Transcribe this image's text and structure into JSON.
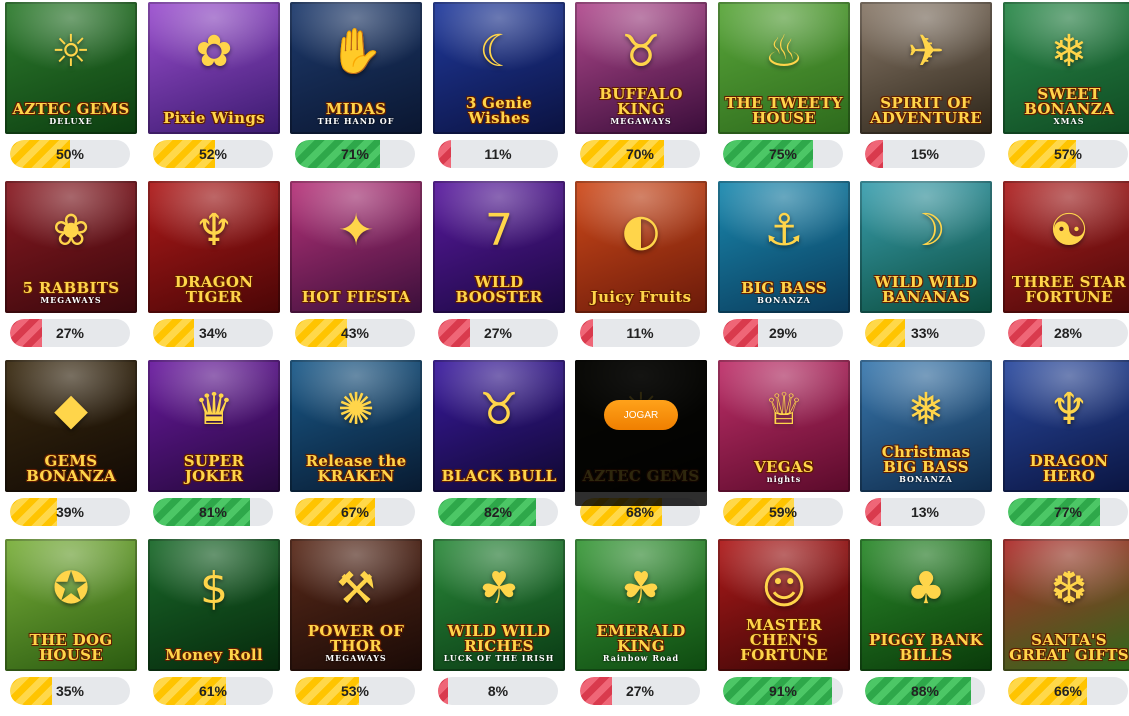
{
  "play_button_label": "JOGAR",
  "colors": {
    "high": "#2ea84a",
    "mid": "#ffc400",
    "low": "#d93a4d",
    "track": "#e6e8eb",
    "play_button": "#f7941d"
  },
  "games": [
    {
      "title": "AZTEC GEMS",
      "subtitle": "DELUXE",
      "percent": "50%",
      "value": 50,
      "level": "yellow",
      "icon": "aztec-mask-icon",
      "bg": [
        "#2e7d2e",
        "#0c3d10"
      ]
    },
    {
      "title": "Pixie Wings",
      "subtitle": "",
      "percent": "52%",
      "value": 52,
      "level": "yellow",
      "icon": "fairy-icon",
      "bg": [
        "#9c4fd0",
        "#3a1a6e"
      ]
    },
    {
      "title": "MIDAS",
      "subtitle": "THE HAND OF",
      "percent": "71%",
      "value": 71,
      "level": "green",
      "icon": "golden-hand-icon",
      "bg": [
        "#1e3b6e",
        "#0a1630"
      ]
    },
    {
      "title": "3 Genie Wishes",
      "subtitle": "",
      "percent": "11%",
      "value": 11,
      "level": "red",
      "icon": "genie-icon",
      "bg": [
        "#203a9e",
        "#0b1240"
      ]
    },
    {
      "title": "BUFFALO KING",
      "subtitle": "MEGAWAYS",
      "percent": "70%",
      "value": 70,
      "level": "yellow",
      "icon": "buffalo-icon",
      "bg": [
        "#b24a8e",
        "#3a0d3a"
      ]
    },
    {
      "title": "THE TWEETY HOUSE",
      "subtitle": "",
      "percent": "75%",
      "value": 75,
      "level": "green",
      "icon": "rooster-icon",
      "bg": [
        "#5aa73a",
        "#2d6a1c"
      ]
    },
    {
      "title": "SPIRIT OF ADVENTURE",
      "subtitle": "",
      "percent": "15%",
      "value": 15,
      "level": "red",
      "icon": "aviator-icon",
      "bg": [
        "#8a7a6a",
        "#2c2418"
      ]
    },
    {
      "title": "SWEET BONANZA",
      "subtitle": "XMAS",
      "percent": "57%",
      "value": 57,
      "level": "yellow",
      "icon": "candy-icon",
      "bg": [
        "#2a8a4a",
        "#0f4a22"
      ]
    },
    {
      "title": "5 RABBITS",
      "subtitle": "MEGAWAYS",
      "percent": "27%",
      "value": 27,
      "level": "red",
      "icon": "rabbit-icon",
      "bg": [
        "#8a1a22",
        "#3a080c"
      ]
    },
    {
      "title": "DRAGON TIGER",
      "subtitle": "",
      "percent": "34%",
      "value": 34,
      "level": "yellow",
      "icon": "dragon-icon",
      "bg": [
        "#b01a1a",
        "#4a0606"
      ]
    },
    {
      "title": "HOT FIESTA",
      "subtitle": "",
      "percent": "43%",
      "value": 43,
      "level": "yellow",
      "icon": "pinata-icon",
      "bg": [
        "#b8337a",
        "#3a0f3a"
      ]
    },
    {
      "title": "WILD BOOSTER",
      "subtitle": "",
      "percent": "27%",
      "value": 27,
      "level": "red",
      "icon": "lucky-seven-icon",
      "bg": [
        "#5a1aa0",
        "#1a0840"
      ]
    },
    {
      "title": "Juicy Fruits",
      "subtitle": "",
      "percent": "11%",
      "value": 11,
      "level": "red",
      "icon": "watermelon-icon",
      "bg": [
        "#d04a1a",
        "#6a1a0a"
      ]
    },
    {
      "title": "BIG BASS",
      "subtitle": "BONANZA",
      "percent": "29%",
      "value": 29,
      "level": "red",
      "icon": "fisherman-icon",
      "bg": [
        "#1a8ab0",
        "#0a3a5a"
      ]
    },
    {
      "title": "WILD WILD BANANAS",
      "subtitle": "",
      "percent": "33%",
      "value": 33,
      "level": "yellow",
      "icon": "banana-icon",
      "bg": [
        "#3aa0b0",
        "#0a4a3a"
      ]
    },
    {
      "title": "THREE STAR FORTUNE",
      "subtitle": "",
      "percent": "28%",
      "value": 28,
      "level": "red",
      "icon": "deity-icon",
      "bg": [
        "#b02020",
        "#4a0808"
      ]
    },
    {
      "title": "GEMS BONANZA",
      "subtitle": "",
      "percent": "39%",
      "value": 39,
      "level": "yellow",
      "icon": "gem-icon",
      "bg": [
        "#3a2a10",
        "#120a04"
      ]
    },
    {
      "title": "SUPER JOKER",
      "subtitle": "",
      "percent": "81%",
      "value": 81,
      "level": "green",
      "icon": "joker-icon",
      "bg": [
        "#6a1aa0",
        "#24083a"
      ]
    },
    {
      "title": "Release the KRAKEN",
      "subtitle": "",
      "percent": "67%",
      "value": 67,
      "level": "yellow",
      "icon": "kraken-icon",
      "bg": [
        "#1a5a8a",
        "#081a30"
      ]
    },
    {
      "title": "BLACK BULL",
      "subtitle": "",
      "percent": "82%",
      "value": 82,
      "level": "green",
      "icon": "bull-icon",
      "bg": [
        "#3a1aa0",
        "#100830"
      ]
    },
    {
      "title": "AZTEC GEMS",
      "subtitle": "",
      "percent": "68%",
      "value": 68,
      "level": "yellow",
      "icon": "aztec-mask-icon",
      "bg": [
        "#2a2a18",
        "#0a0a06"
      ],
      "hovered": true
    },
    {
      "title": "VEGAS",
      "subtitle": "nights",
      "percent": "59%",
      "value": 59,
      "level": "yellow",
      "icon": "showgirl-icon",
      "bg": [
        "#c0306a",
        "#5a0a2a"
      ]
    },
    {
      "title": "Christmas BIG BASS",
      "subtitle": "BONANZA",
      "percent": "13%",
      "value": 13,
      "level": "red",
      "icon": "santa-fish-icon",
      "bg": [
        "#3a7ab0",
        "#0e2a4a"
      ]
    },
    {
      "title": "DRAGON HERO",
      "subtitle": "",
      "percent": "77%",
      "value": 77,
      "level": "green",
      "icon": "dragon-icon",
      "bg": [
        "#2a4aa0",
        "#0a1440"
      ]
    },
    {
      "title": "THE DOG HOUSE",
      "subtitle": "",
      "percent": "35%",
      "value": 35,
      "level": "yellow",
      "icon": "dog-icon",
      "bg": [
        "#7ab03a",
        "#2a5a10"
      ]
    },
    {
      "title": "Money Roll",
      "subtitle": "",
      "percent": "61%",
      "value": 61,
      "level": "yellow",
      "icon": "money-roll-icon",
      "bg": [
        "#1a6a2a",
        "#06280c"
      ]
    },
    {
      "title": "POWER OF THOR",
      "subtitle": "MEGAWAYS",
      "percent": "53%",
      "value": 53,
      "level": "yellow",
      "icon": "hammer-icon",
      "bg": [
        "#5a2a1a",
        "#1a0a06"
      ]
    },
    {
      "title": "WILD WILD RICHES",
      "subtitle": "LUCK OF THE IRISH",
      "percent": "8%",
      "value": 8,
      "level": "red",
      "icon": "leprechaun-hat-icon",
      "bg": [
        "#2a8a3a",
        "#0a3a14"
      ]
    },
    {
      "title": "EMERALD KING",
      "subtitle": "Rainbow Road",
      "percent": "27%",
      "value": 27,
      "level": "red",
      "icon": "leprechaun-icon",
      "bg": [
        "#3a9a3a",
        "#0e4a10"
      ]
    },
    {
      "title": "MASTER CHEN'S FORTUNE",
      "subtitle": "",
      "percent": "91%",
      "value": 91,
      "level": "green",
      "icon": "lucky-cat-icon",
      "bg": [
        "#b01a1a",
        "#3a0606"
      ]
    },
    {
      "title": "PIGGY BANK BILLS",
      "subtitle": "",
      "percent": "88%",
      "value": 88,
      "level": "green",
      "icon": "pig-icon",
      "bg": [
        "#2a8a2a",
        "#0a3a0a"
      ]
    },
    {
      "title": "SANTA'S GREAT GIFTS",
      "subtitle": "",
      "percent": "66%",
      "value": 66,
      "level": "yellow",
      "icon": "santa-icon",
      "bg": [
        "#b02a2a",
        "#2a6a1a"
      ]
    }
  ]
}
